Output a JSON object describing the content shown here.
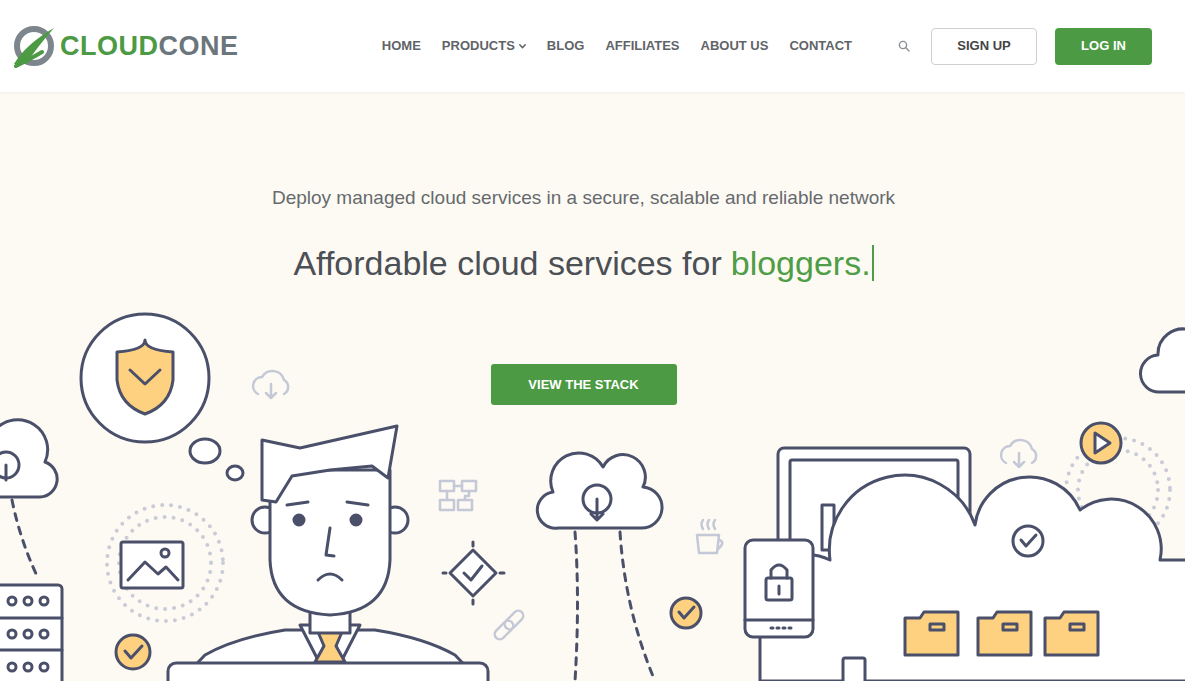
{
  "logo": {
    "text_primary": "CLOUD",
    "text_secondary": "CONE"
  },
  "nav": [
    {
      "label": "HOME",
      "kind": "link"
    },
    {
      "label": "PRODUCTS",
      "kind": "dropdown"
    },
    {
      "label": "BLOG",
      "kind": "link"
    },
    {
      "label": "AFFILIATES",
      "kind": "link"
    },
    {
      "label": "ABOUT US",
      "kind": "link"
    },
    {
      "label": "CONTACT",
      "kind": "link"
    }
  ],
  "actions": {
    "signup": "SIGN UP",
    "login": "LOG IN"
  },
  "hero": {
    "tagline": "Deploy managed cloud services in a secure, scalable and reliable network",
    "headline": "Affordable cloud services for",
    "highlight": "bloggers.",
    "typing_cursor": true,
    "cta": "VIEW THE STACK"
  }
}
